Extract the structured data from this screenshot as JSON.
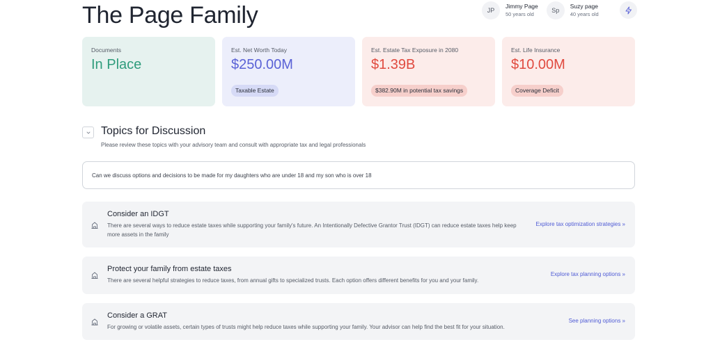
{
  "header": {
    "title": "The Page Family",
    "members": [
      {
        "initials": "JP",
        "name": "Jimmy Page",
        "age": "50 years old"
      },
      {
        "initials": "Sp",
        "name": "Suzy page",
        "age": "40 years old"
      }
    ],
    "action_icon": "lightning-icon"
  },
  "cards": [
    {
      "label": "Documents",
      "value": "In Place",
      "badge": "",
      "color": "#2f9c7c"
    },
    {
      "label": "Est. Net Worth Today",
      "value": "$250.00M",
      "badge": "Taxable Estate",
      "color": "#5a62d6"
    },
    {
      "label": "Est. Estate Tax Exposure in 2080",
      "value": "$1.39B",
      "badge": "$382.90M in potential tax savings",
      "color": "#e04a3f"
    },
    {
      "label": "Est. Life Insurance",
      "value": "$10.00M",
      "badge": "Coverage Deficit",
      "color": "#e04a3f"
    }
  ],
  "topics": {
    "title": "Topics for Discussion",
    "subtitle": "Please review these topics with your advisory team and consult with appropriate tax and legal professionals",
    "question": "Can we discuss options and decisions to be made for my daughters who are under 18 and my son who is over 18",
    "items": [
      {
        "title": "Consider an IDGT",
        "description": "There are several ways to reduce estate taxes while supporting your family's future. An Intentionally Defective Grantor Trust (IDGT) can reduce estate taxes help keep more assets in the family",
        "link": "Explore tax optimization strategies »"
      },
      {
        "title": "Protect your family from estate taxes",
        "description": "There are several helpful strategies to reduce taxes, from annual gifts to specialized trusts. Each option offers different benefits for you and your family.",
        "link": "Explore tax planning options »"
      },
      {
        "title": "Consider a GRAT",
        "description": "For growing or volatile assets, certain types of trusts might help reduce taxes while supporting your family. Your advisor can help find the best fit for your situation.",
        "link": "See planning options »"
      }
    ]
  },
  "colors": {
    "accent": "#4f5bd5",
    "green_card": "#e6f2ef",
    "blue_card": "#eceefb",
    "red_card": "#fcecea"
  }
}
